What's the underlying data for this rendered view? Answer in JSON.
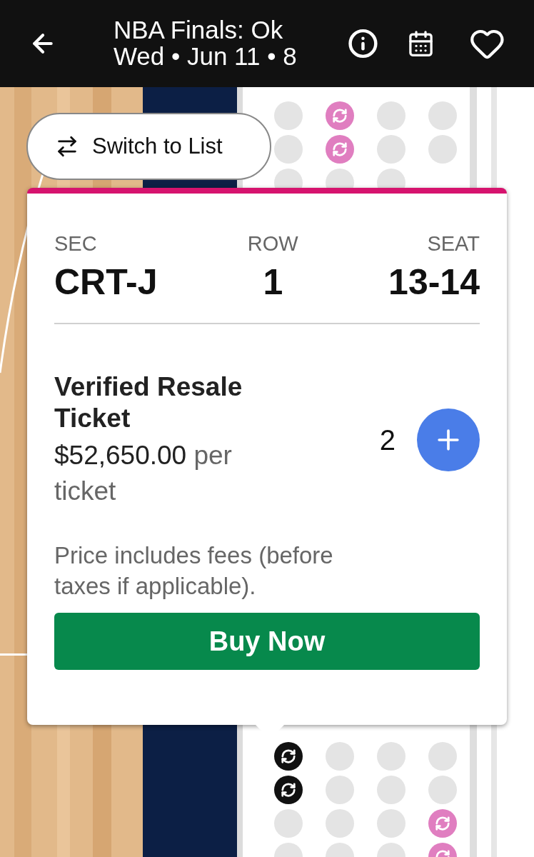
{
  "header": {
    "title": "NBA Finals: Ok",
    "subtitle": "Wed • Jun 11 • 8"
  },
  "switch_button": {
    "label": "Switch to List"
  },
  "seat_map": {
    "top_rows": [
      {
        "seats": [
          {
            "kind": "available"
          },
          {
            "kind": "resale"
          },
          {
            "kind": "available"
          },
          {
            "kind": "available"
          }
        ]
      },
      {
        "seats": [
          {
            "kind": "available"
          },
          {
            "kind": "resale"
          },
          {
            "kind": "available"
          },
          {
            "kind": "available"
          }
        ]
      },
      {
        "seats": [
          {
            "kind": "available"
          },
          {
            "kind": "available"
          },
          {
            "kind": "available"
          }
        ]
      }
    ],
    "bottom_rows": [
      {
        "seats": [
          {
            "kind": "selected"
          },
          {
            "kind": "available"
          },
          {
            "kind": "available"
          },
          {
            "kind": "available"
          }
        ]
      },
      {
        "seats": [
          {
            "kind": "selected"
          },
          {
            "kind": "available"
          },
          {
            "kind": "available"
          },
          {
            "kind": "available"
          }
        ]
      },
      {
        "seats": [
          {
            "kind": "available"
          },
          {
            "kind": "available"
          },
          {
            "kind": "available"
          },
          {
            "kind": "resale"
          }
        ]
      },
      {
        "seats": [
          {
            "kind": "available"
          },
          {
            "kind": "available"
          },
          {
            "kind": "available"
          },
          {
            "kind": "resale"
          }
        ]
      }
    ]
  },
  "ticket": {
    "columns": [
      {
        "label": "SEC",
        "value": "CRT-J"
      },
      {
        "label": "ROW",
        "value": "1"
      },
      {
        "label": "SEAT",
        "value": "13-14"
      }
    ],
    "type": "Verified Resale Ticket",
    "price": "$52,650.00",
    "price_unit": "per ticket",
    "quantity": "2",
    "fee_note": "Price includes fees (before taxes if applicable).",
    "buy_button": "Buy Now"
  }
}
